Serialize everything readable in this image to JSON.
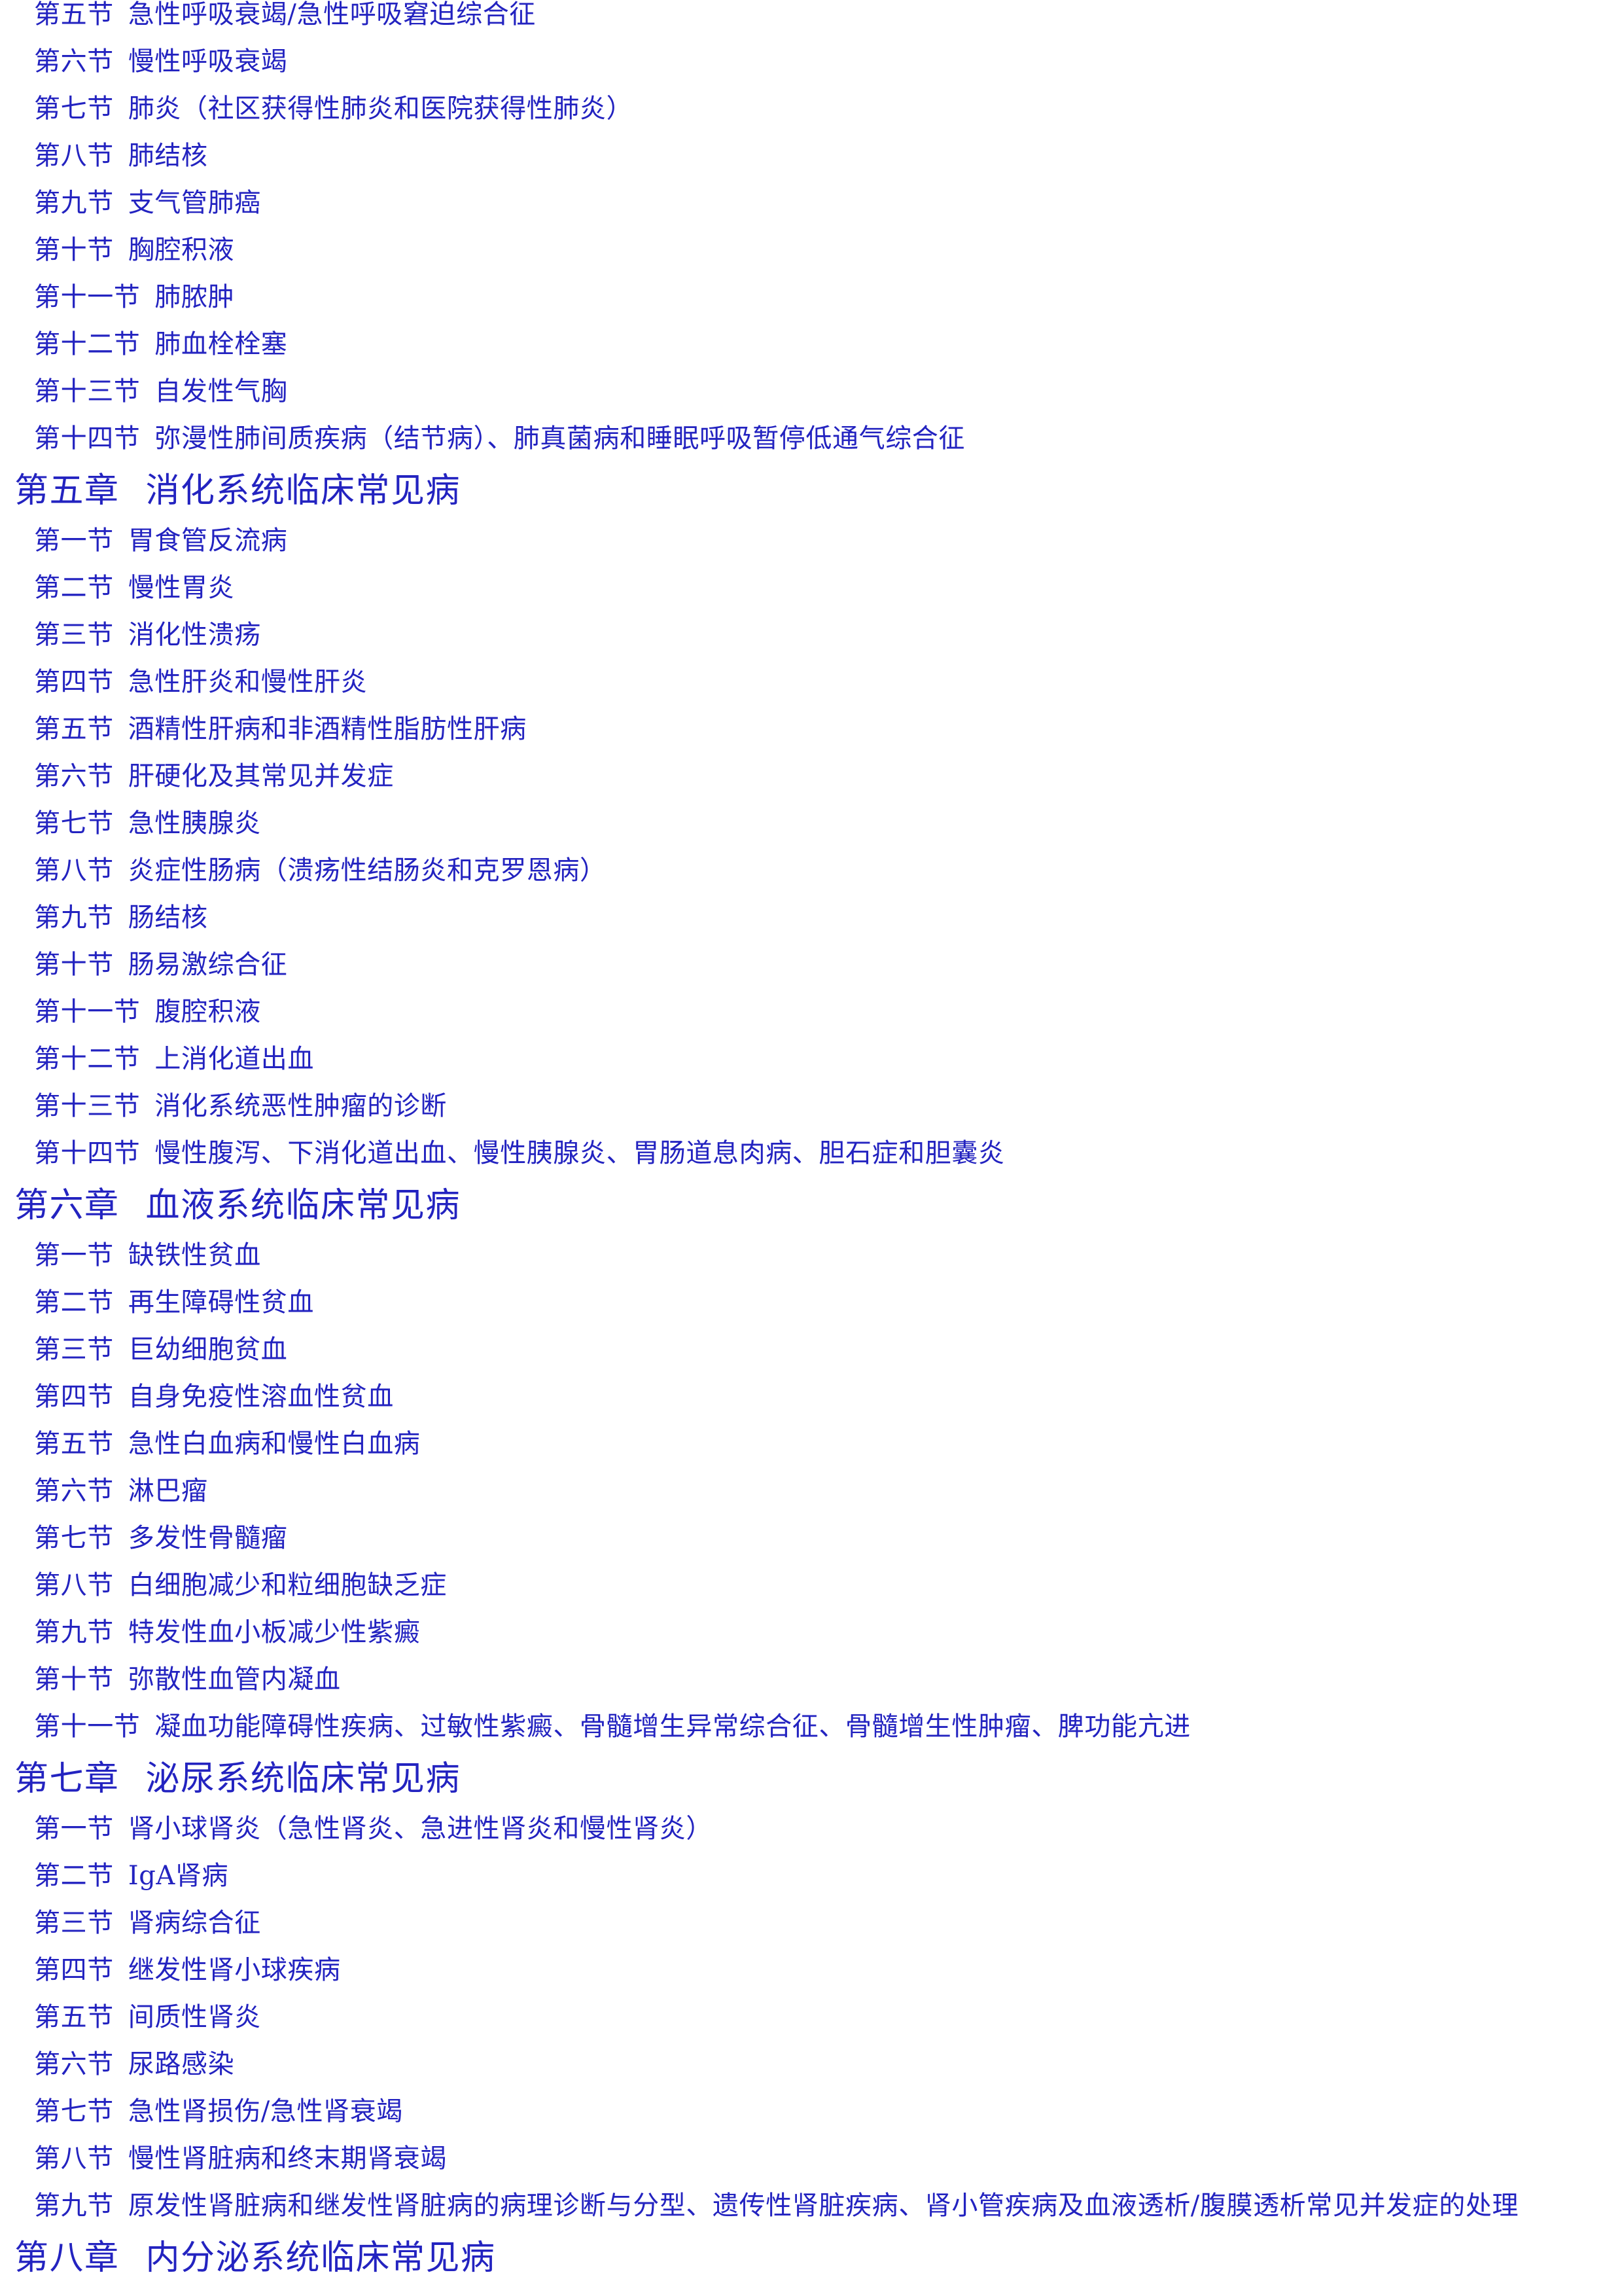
{
  "document": {
    "type": "table-of-contents",
    "language": "zh-CN",
    "text_color": "#2323c0",
    "background_color": "#ffffff"
  },
  "chapters": [
    {
      "continued": true,
      "number": "",
      "title": "",
      "sections": [
        {
          "number": "第五节",
          "title": "急性呼吸衰竭/急性呼吸窘迫综合征"
        },
        {
          "number": "第六节",
          "title": "慢性呼吸衰竭"
        },
        {
          "number": "第七节",
          "title": "肺炎（社区获得性肺炎和医院获得性肺炎）"
        },
        {
          "number": "第八节",
          "title": "肺结核"
        },
        {
          "number": "第九节",
          "title": "支气管肺癌"
        },
        {
          "number": "第十节",
          "title": "胸腔积液"
        },
        {
          "number": "第十一节",
          "title": "肺脓肿"
        },
        {
          "number": "第十二节",
          "title": "肺血栓栓塞"
        },
        {
          "number": "第十三节",
          "title": "自发性气胸"
        },
        {
          "number": "第十四节",
          "title": "弥漫性肺间质疾病（结节病）、肺真菌病和睡眠呼吸暂停低通气综合征"
        }
      ]
    },
    {
      "continued": false,
      "number": "第五章",
      "title": "消化系统临床常见病",
      "sections": [
        {
          "number": "第一节",
          "title": "胃食管反流病"
        },
        {
          "number": "第二节",
          "title": "慢性胃炎"
        },
        {
          "number": "第三节",
          "title": "消化性溃疡"
        },
        {
          "number": "第四节",
          "title": "急性肝炎和慢性肝炎"
        },
        {
          "number": "第五节",
          "title": "酒精性肝病和非酒精性脂肪性肝病"
        },
        {
          "number": "第六节",
          "title": "肝硬化及其常见并发症"
        },
        {
          "number": "第七节",
          "title": "急性胰腺炎"
        },
        {
          "number": "第八节",
          "title": "炎症性肠病（溃疡性结肠炎和克罗恩病）"
        },
        {
          "number": "第九节",
          "title": "肠结核"
        },
        {
          "number": "第十节",
          "title": "肠易激综合征"
        },
        {
          "number": "第十一节",
          "title": "腹腔积液"
        },
        {
          "number": "第十二节",
          "title": "上消化道出血"
        },
        {
          "number": "第十三节",
          "title": "消化系统恶性肿瘤的诊断"
        },
        {
          "number": "第十四节",
          "title": "慢性腹泻、下消化道出血、慢性胰腺炎、胃肠道息肉病、胆石症和胆囊炎"
        }
      ]
    },
    {
      "continued": false,
      "number": "第六章",
      "title": "血液系统临床常见病",
      "sections": [
        {
          "number": "第一节",
          "title": "缺铁性贫血"
        },
        {
          "number": "第二节",
          "title": "再生障碍性贫血"
        },
        {
          "number": "第三节",
          "title": "巨幼细胞贫血"
        },
        {
          "number": "第四节",
          "title": "自身免疫性溶血性贫血"
        },
        {
          "number": "第五节",
          "title": "急性白血病和慢性白血病"
        },
        {
          "number": "第六节",
          "title": "淋巴瘤"
        },
        {
          "number": "第七节",
          "title": "多发性骨髓瘤"
        },
        {
          "number": "第八节",
          "title": "白细胞减少和粒细胞缺乏症"
        },
        {
          "number": "第九节",
          "title": "特发性血小板减少性紫癜"
        },
        {
          "number": "第十节",
          "title": "弥散性血管内凝血"
        },
        {
          "number": "第十一节",
          "title": "凝血功能障碍性疾病、过敏性紫癜、骨髓增生异常综合征、骨髓增生性肿瘤、脾功能亢进"
        }
      ]
    },
    {
      "continued": false,
      "number": "第七章",
      "title": "泌尿系统临床常见病",
      "sections": [
        {
          "number": "第一节",
          "title": "肾小球肾炎（急性肾炎、急进性肾炎和慢性肾炎）"
        },
        {
          "number": "第二节",
          "title": "IgA肾病"
        },
        {
          "number": "第三节",
          "title": "肾病综合征"
        },
        {
          "number": "第四节",
          "title": "继发性肾小球疾病"
        },
        {
          "number": "第五节",
          "title": "间质性肾炎"
        },
        {
          "number": "第六节",
          "title": "尿路感染"
        },
        {
          "number": "第七节",
          "title": "急性肾损伤/急性肾衰竭"
        },
        {
          "number": "第八节",
          "title": "慢性肾脏病和终末期肾衰竭"
        },
        {
          "number": "第九节",
          "title": "原发性肾脏病和继发性肾脏病的病理诊断与分型、遗传性肾脏疾病、肾小管疾病及血液透析/腹膜透析常见并发症的处理"
        }
      ]
    },
    {
      "continued": false,
      "number": "第八章",
      "title": "内分泌系统临床常见病",
      "sections": []
    }
  ]
}
